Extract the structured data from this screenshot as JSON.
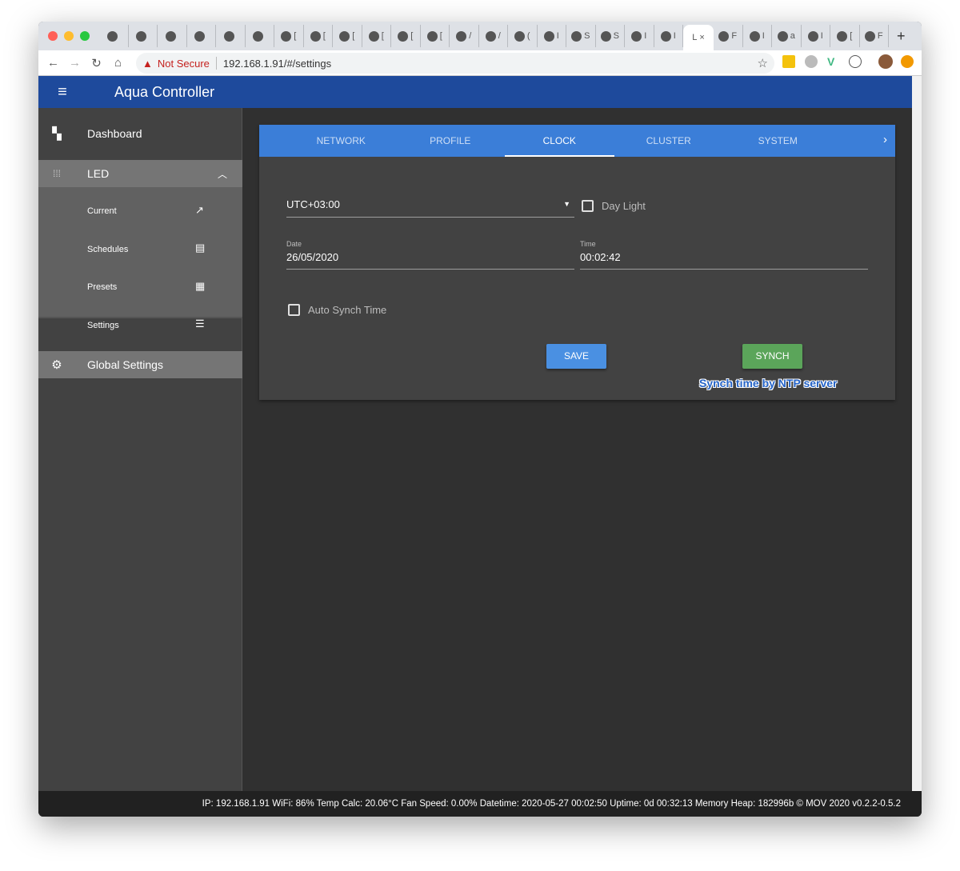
{
  "browser": {
    "tabs": [
      "",
      "",
      "",
      "",
      "",
      "",
      "[",
      "[",
      "[",
      "[",
      "[",
      "[",
      "/",
      "/",
      "(",
      "I",
      "S",
      "S",
      "I",
      "I",
      "L",
      "F",
      "I",
      "a",
      "I",
      "[",
      "F"
    ],
    "active_tab": 20,
    "address": {
      "security": "Not Secure",
      "url": "192.168.1.91/#/settings"
    }
  },
  "app": {
    "title": "Aqua Controller"
  },
  "sidebar": {
    "dashboard": "Dashboard",
    "led": "LED",
    "led_items": [
      {
        "label": "Current",
        "icon": "trending-up-icon"
      },
      {
        "label": "Schedules",
        "icon": "library-books-icon"
      },
      {
        "label": "Presets",
        "icon": "grid-icon"
      },
      {
        "label": "Settings",
        "icon": "tune-icon"
      }
    ],
    "global_settings": "Global Settings"
  },
  "settings": {
    "tabs": [
      "NETWORK",
      "PROFILE",
      "CLOCK",
      "CLUSTER",
      "SYSTEM"
    ],
    "active_tab": "CLOCK",
    "timezone": "UTC+03:00",
    "day_light_label": "Day Light",
    "day_light_checked": false,
    "date_label": "Date",
    "date_value": "26/05/2020",
    "time_label": "Time",
    "time_value": "00:02:42",
    "auto_synch_label": "Auto Synch Time",
    "auto_synch_checked": false,
    "save_label": "SAVE",
    "synch_label": "SYNCH",
    "annotation": "Synch time by NTP server"
  },
  "footer": {
    "status": "IP: 192.168.1.91 WiFi: 86% Temp Calc: 20.06°C Fan Speed: 0.00% Datetime: 2020-05-27 00:02:50 Uptime: 0d 00:32:13 Memory Heap: 182996b © MOV 2020 v0.2.2-0.5.2"
  },
  "colors": {
    "header": "#1e4a9c",
    "tabs": "#3b7ed8",
    "save": "#4a90e2",
    "synch": "#5ba55a"
  }
}
